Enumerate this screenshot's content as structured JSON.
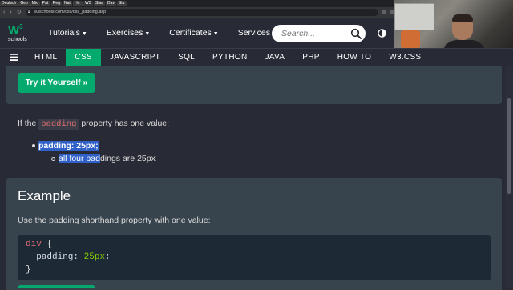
{
  "browser": {
    "tabs": [
      "Deutsch",
      "Geo",
      "Mic",
      "Pat",
      "Reg",
      "Nat",
      "Ho",
      "W3",
      "Stac",
      "Dav",
      "Stu"
    ],
    "url": "w3schools.com/css/css_padding.asp",
    "nav": {
      "back": "‹",
      "forward": "›",
      "reload": "↻"
    }
  },
  "logo": {
    "mark": "W",
    "superscript": "3",
    "sub": "schools"
  },
  "top_menu": [
    {
      "label": "Tutorials"
    },
    {
      "label": "Exercises"
    },
    {
      "label": "Certificates"
    },
    {
      "label": "Services"
    }
  ],
  "search": {
    "placeholder": "Search..."
  },
  "subnav": {
    "items": [
      "HTML",
      "CSS",
      "JAVASCRIPT",
      "SQL",
      "PYTHON",
      "JAVA",
      "PHP",
      "HOW TO",
      "W3.CSS"
    ],
    "active": "CSS"
  },
  "content": {
    "try_button": "Try it Yourself »",
    "para_prefix": "If the",
    "para_code": "padding",
    "para_suffix": "property has one value:",
    "bullet_strong": "padding: 25px;",
    "sub_bullet_highlight": "all four pad",
    "sub_bullet_rest": "dings are 25px",
    "example_title": "Example",
    "example_desc": "Use the padding shorthand property with one value:",
    "code": {
      "selector": "div",
      "open_brace": "{",
      "property": "padding",
      "colon": ":",
      "value": "25px",
      "semicolon": ";",
      "close_brace": "}"
    }
  },
  "colors": {
    "accent": "#04aa6d",
    "background": "#282a35",
    "card": "#38444d",
    "code_bg": "#1d2a35",
    "highlight": "#3061c9"
  },
  "icons": {
    "search": "search-icon",
    "contrast": "contrast-toggle-icon",
    "menu": "hamburger-menu-icon"
  }
}
